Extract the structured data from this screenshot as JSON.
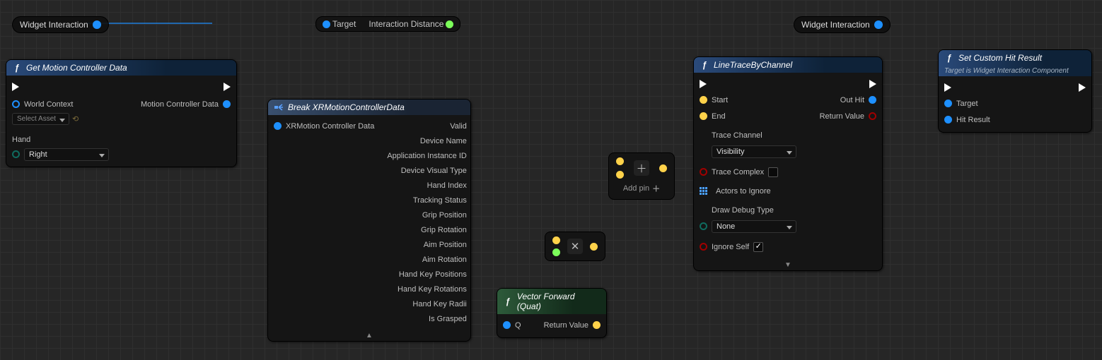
{
  "vars": {
    "widgetInteraction1": "Widget Interaction",
    "widgetInteraction2": "Widget Interaction"
  },
  "knot": {
    "target": "Target",
    "interactionDistance": "Interaction Distance"
  },
  "getMC": {
    "title": "Get Motion Controller Data",
    "in": {
      "worldContext": "World Context",
      "selectAsset": "Select Asset",
      "hand": "Hand",
      "handValue": "Right"
    },
    "out": {
      "data": "Motion Controller Data"
    }
  },
  "breakXR": {
    "title": "Break XRMotionControllerData",
    "in": "XRMotion Controller Data",
    "out": {
      "valid": "Valid",
      "deviceName": "Device Name",
      "appId": "Application Instance ID",
      "visualType": "Device Visual Type",
      "handIndex": "Hand Index",
      "tracking": "Tracking Status",
      "gripPos": "Grip Position",
      "gripRot": "Grip Rotation",
      "aimPos": "Aim Position",
      "aimRot": "Aim Rotation",
      "handKeyPos": "Hand Key Positions",
      "handKeyRot": "Hand Key Rotations",
      "handKeyRadii": "Hand Key Radii",
      "isGrasped": "Is Grasped"
    }
  },
  "vecForward": {
    "title": "Vector Forward (Quat)",
    "in": "Q",
    "out": "Return Value"
  },
  "addNode": {
    "addPin": "Add pin"
  },
  "lineTrace": {
    "title": "LineTraceByChannel",
    "in": {
      "start": "Start",
      "end": "End",
      "traceChannel": "Trace Channel",
      "traceChannelValue": "Visibility",
      "traceComplex": "Trace Complex",
      "actorsIgnore": "Actors to Ignore",
      "drawDebug": "Draw Debug Type",
      "drawDebugValue": "None",
      "ignoreSelf": "Ignore Self"
    },
    "out": {
      "outHit": "Out Hit",
      "returnValue": "Return Value"
    }
  },
  "setHit": {
    "title": "Set Custom Hit Result",
    "sub": "Target is Widget Interaction Component",
    "target": "Target",
    "hitResult": "Hit Result"
  }
}
